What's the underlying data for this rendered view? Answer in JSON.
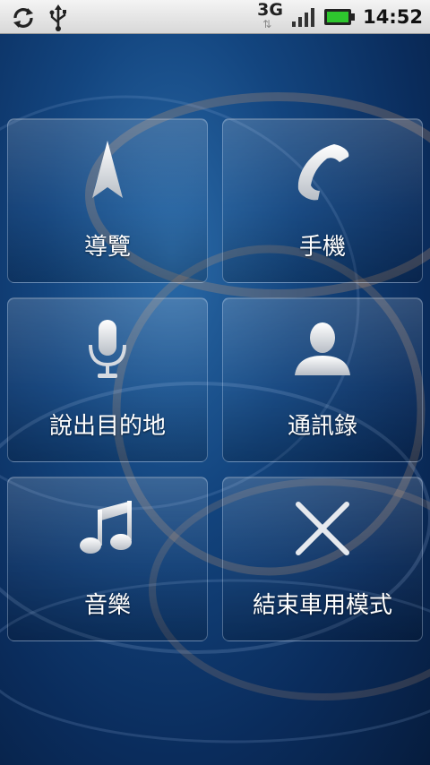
{
  "status_bar": {
    "network": "3G",
    "time": "14:52"
  },
  "tiles": [
    {
      "label": "導覽",
      "icon": "navigation-arrow-icon"
    },
    {
      "label": "手機",
      "icon": "phone-icon"
    },
    {
      "label": "說出目的地",
      "icon": "microphone-icon"
    },
    {
      "label": "通訊錄",
      "icon": "contacts-icon"
    },
    {
      "label": "音樂",
      "icon": "music-note-icon"
    },
    {
      "label": "結束車用模式",
      "icon": "close-icon"
    }
  ],
  "colors": {
    "background": "#0a2a55",
    "battery": "#2ec62e"
  }
}
